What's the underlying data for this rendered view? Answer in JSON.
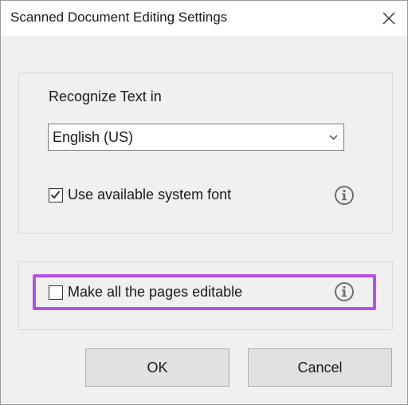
{
  "dialog": {
    "title": "Scanned Document Editing Settings",
    "close_icon": "close-icon"
  },
  "ocr": {
    "recognize_label": "Recognize Text in",
    "language_selected": "English (US)",
    "system_font_label": "Use available system font",
    "system_font_checked": true
  },
  "editing": {
    "all_pages_label": "Make all the pages editable",
    "all_pages_checked": false
  },
  "buttons": {
    "ok": "OK",
    "cancel": "Cancel"
  },
  "colors": {
    "highlight": "#b44ff0",
    "dialog_bg": "#f0f0f0"
  }
}
